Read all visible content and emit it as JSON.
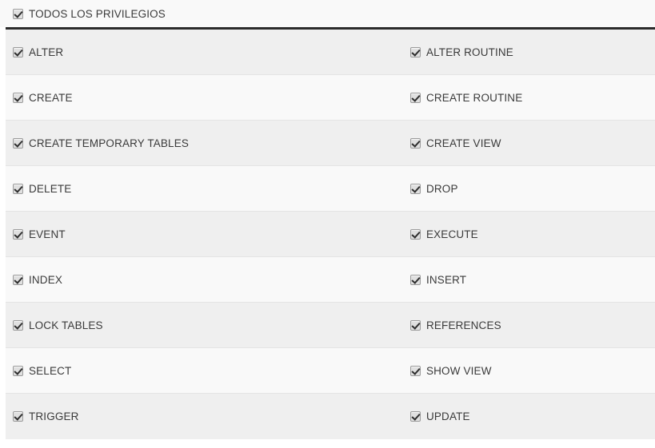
{
  "panel": {
    "name": "privileges-panel",
    "colors": {
      "page_background": "#ffffff",
      "row_shade_dark": "#efefef",
      "row_shade_light": "#f9f9f9",
      "header_background": "#f9f9f9",
      "header_rule": "#2b2b2b",
      "row_separator": "#e4e4e4",
      "text": "#3a3a3a",
      "checkbox_fill": "#e0e0e0",
      "checkbox_border": "#9a9a9a",
      "checkmark": "#2e2e2e"
    }
  },
  "header": {
    "label": "TODOS LOS PRIVILEGIOS",
    "checked": true,
    "checkbox_icon": "checkbox-checked-icon"
  },
  "privileges": {
    "checkbox_icon": "checkbox-checked-icon",
    "rows": [
      {
        "shade": "dark",
        "left": {
          "label": "ALTER",
          "checked": true
        },
        "right": {
          "label": "ALTER ROUTINE",
          "checked": true
        }
      },
      {
        "shade": "light",
        "left": {
          "label": "CREATE",
          "checked": true
        },
        "right": {
          "label": "CREATE ROUTINE",
          "checked": true
        }
      },
      {
        "shade": "dark",
        "left": {
          "label": "CREATE TEMPORARY TABLES",
          "checked": true
        },
        "right": {
          "label": "CREATE VIEW",
          "checked": true
        }
      },
      {
        "shade": "light",
        "left": {
          "label": "DELETE",
          "checked": true
        },
        "right": {
          "label": "DROP",
          "checked": true
        }
      },
      {
        "shade": "dark",
        "left": {
          "label": "EVENT",
          "checked": true
        },
        "right": {
          "label": "EXECUTE",
          "checked": true
        }
      },
      {
        "shade": "light",
        "left": {
          "label": "INDEX",
          "checked": true
        },
        "right": {
          "label": "INSERT",
          "checked": true
        }
      },
      {
        "shade": "dark",
        "left": {
          "label": "LOCK TABLES",
          "checked": true
        },
        "right": {
          "label": "REFERENCES",
          "checked": true
        }
      },
      {
        "shade": "light",
        "left": {
          "label": "SELECT",
          "checked": true
        },
        "right": {
          "label": "SHOW VIEW",
          "checked": true
        }
      },
      {
        "shade": "dark",
        "left": {
          "label": "TRIGGER",
          "checked": true
        },
        "right": {
          "label": "UPDATE",
          "checked": true
        }
      }
    ]
  }
}
